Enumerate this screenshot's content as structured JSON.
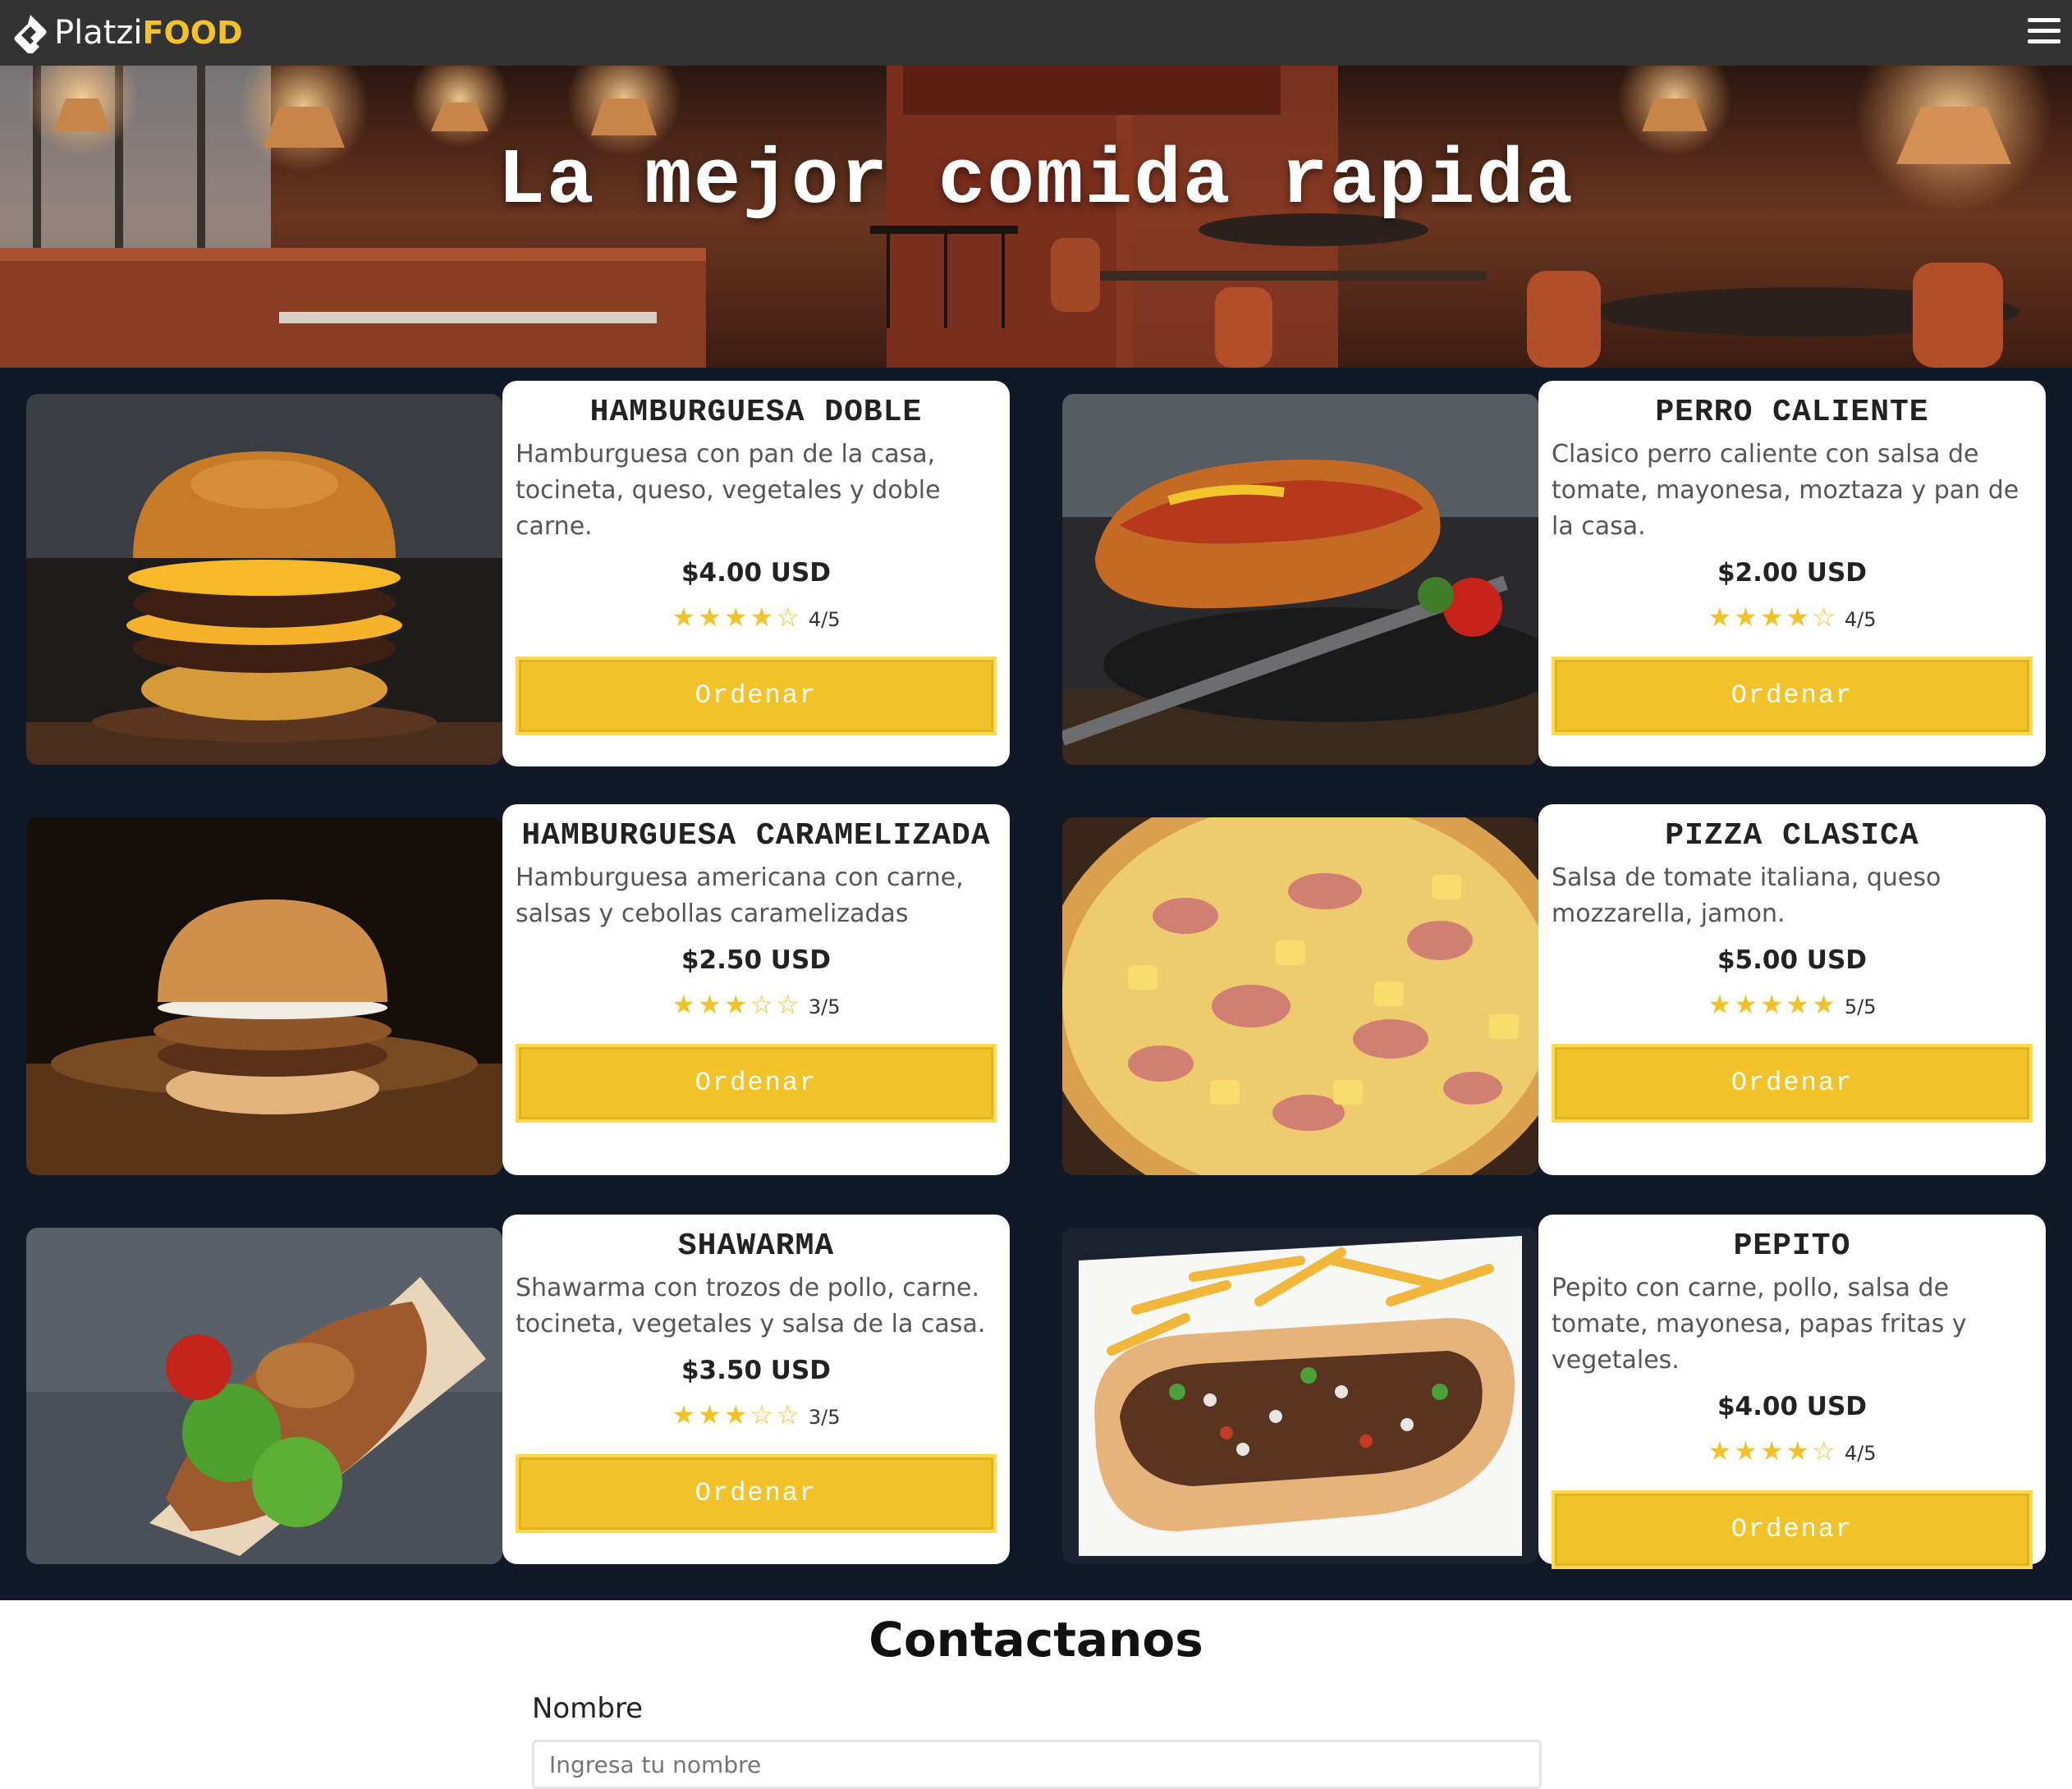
{
  "navbar": {
    "logo_text": "Platzi",
    "logo_accent": "FOOD",
    "menu_icon": "hamburger-menu-icon"
  },
  "hero": {
    "title": "La mejor comida rapida"
  },
  "menu": {
    "items": [
      {
        "name": "HAMBURGUESA DOBLE",
        "description": "Hamburguesa con pan de la casa, tocineta, queso, vegetales y doble carne.",
        "price": "$4.00 USD",
        "stars": "★★★★☆",
        "score": "4/5",
        "button": "Ordenar",
        "image": "double-burger"
      },
      {
        "name": "PERRO CALIENTE",
        "description": "Clasico perro caliente con salsa de tomate, mayonesa, moztaza y pan de la casa.",
        "price": "$2.00 USD",
        "stars": "★★★★☆",
        "score": "4/5",
        "button": "Ordenar",
        "image": "hot-dog"
      },
      {
        "name": "HAMBURGUESA CARAMELIZADA",
        "description": "Hamburguesa americana con carne, salsas y cebollas caramelizadas",
        "price": "$2.50 USD",
        "stars": "★★★☆☆",
        "score": "3/5",
        "button": "Ordenar",
        "image": "caramelized-burger"
      },
      {
        "name": "PIZZA CLASICA",
        "description": "Salsa de tomate italiana, queso mozzarella, jamon.",
        "price": "$5.00 USD",
        "stars": "★★★★★",
        "score": "5/5",
        "button": "Ordenar",
        "image": "pizza"
      },
      {
        "name": "SHAWARMA",
        "description": "Shawarma con trozos de pollo, carne. tocineta, vegetales y salsa de la casa.",
        "price": "$3.50 USD",
        "stars": "★★★☆☆",
        "score": "3/5",
        "button": "Ordenar",
        "image": "shawarma"
      },
      {
        "name": "PEPITO",
        "description": "Pepito con carne, pollo, salsa de tomate, mayonesa, papas fritas y vegetales.",
        "price": "$4.00 USD",
        "stars": "★★★★☆",
        "score": "4/5",
        "button": "Ordenar",
        "image": "pepito"
      }
    ]
  },
  "contact": {
    "title": "Contactanos",
    "name_label": "Nombre",
    "name_placeholder": "Ingresa tu nombre"
  },
  "colors": {
    "navbar_bg": "#333333",
    "accent_yellow": "#f2c22b",
    "menu_bg": "#111827",
    "card_bg": "#ffffff"
  }
}
